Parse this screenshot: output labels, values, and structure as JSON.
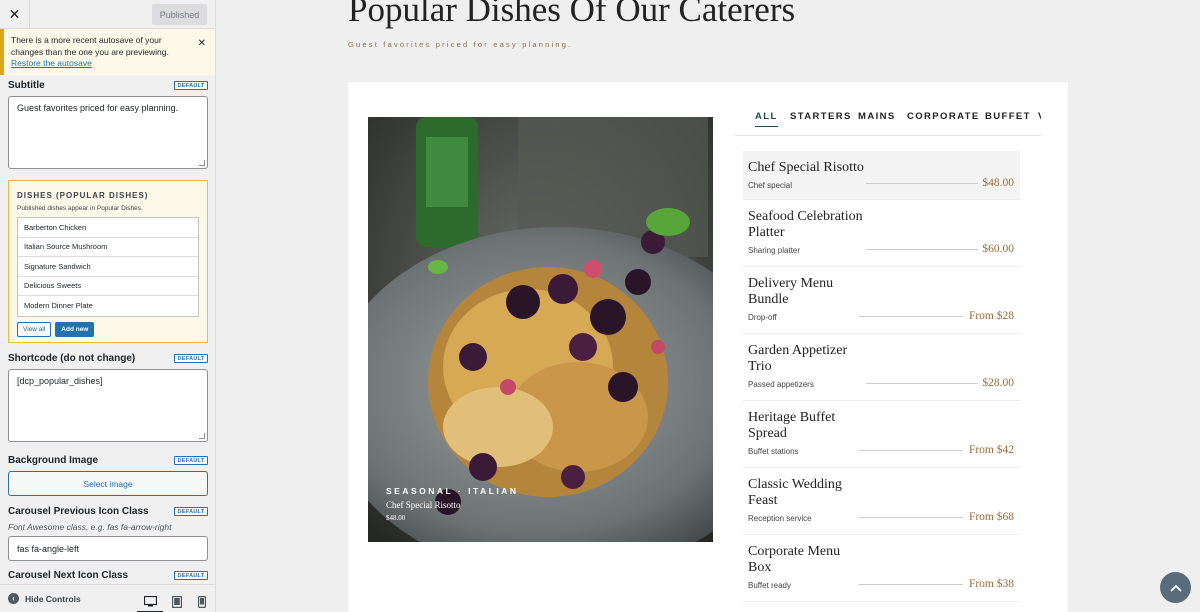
{
  "sidebar": {
    "header": {
      "published_label": "Published"
    },
    "notice": {
      "text": "There is a more recent autosave of your changes than the one you are previewing.",
      "link": "Restore the autosave"
    },
    "default_badge": "DEFAULT",
    "subtitle": {
      "label": "Subtitle",
      "value": "Guest favorites priced for easy planning."
    },
    "dishes": {
      "title": "DISHES (POPULAR DISHES)",
      "description": "Published dishes appear in Popular Dishes.",
      "items": [
        "Barberton Chicken",
        "Italian Source Mushroom",
        "Signature Sandwich",
        "Delicious Sweets",
        "Modern Dinner Plate"
      ],
      "view_all": "View all",
      "add_new": "Add new"
    },
    "shortcode": {
      "label": "Shortcode (do not change)",
      "value": "[dcp_popular_dishes]"
    },
    "background_image": {
      "label": "Background Image",
      "button": "Select image"
    },
    "carousel_prev": {
      "label": "Carousel Previous Icon Class",
      "description": "Font Awesome class, e.g. fas fa-arrow-right",
      "value": "fas fa-angle-left"
    },
    "carousel_next": {
      "label": "Carousel Next Icon Class"
    },
    "footer": {
      "hide_controls": "Hide Controls"
    }
  },
  "preview": {
    "title": "Popular Dishes Of Our Caterers",
    "subtitle": "Guest favorites priced for easy planning.",
    "tabs": [
      "ALL",
      "STARTERS",
      "MAINS",
      "CORPORATE",
      "BUFFET",
      "V"
    ],
    "active_tab": "ALL",
    "featured": {
      "tag": "SEASONAL · ITALIAN",
      "name": "Chef Special Risotto",
      "price": "$48.00"
    },
    "menu_items": [
      {
        "name": "Chef Special Risotto",
        "note": "Chef special",
        "price": "$48.00"
      },
      {
        "name": "Seafood Celebration Platter",
        "note": "Sharing platter",
        "price": "$60.00"
      },
      {
        "name": "Delivery Menu Bundle",
        "note": "Drop-off",
        "price": "From $28"
      },
      {
        "name": "Garden Appetizer Trio",
        "note": "Passed appetizers",
        "price": "$28.00"
      },
      {
        "name": "Heritage Buffet Spread",
        "note": "Buffet stations",
        "price": "From $42"
      },
      {
        "name": "Classic Wedding Feast",
        "note": "Reception service",
        "price": "From $68"
      },
      {
        "name": "Corporate Menu Box",
        "note": "Buffet ready",
        "price": "From $38"
      }
    ]
  },
  "colors": {
    "accent": "#2271b1",
    "notice_border": "#dba617",
    "tab_active": "#1a4f43",
    "price": "#9b6b37"
  },
  "icons": [
    "close-icon",
    "desktop-icon",
    "tablet-icon",
    "mobile-icon",
    "chevron-up-icon",
    "hide-controls-icon"
  ]
}
